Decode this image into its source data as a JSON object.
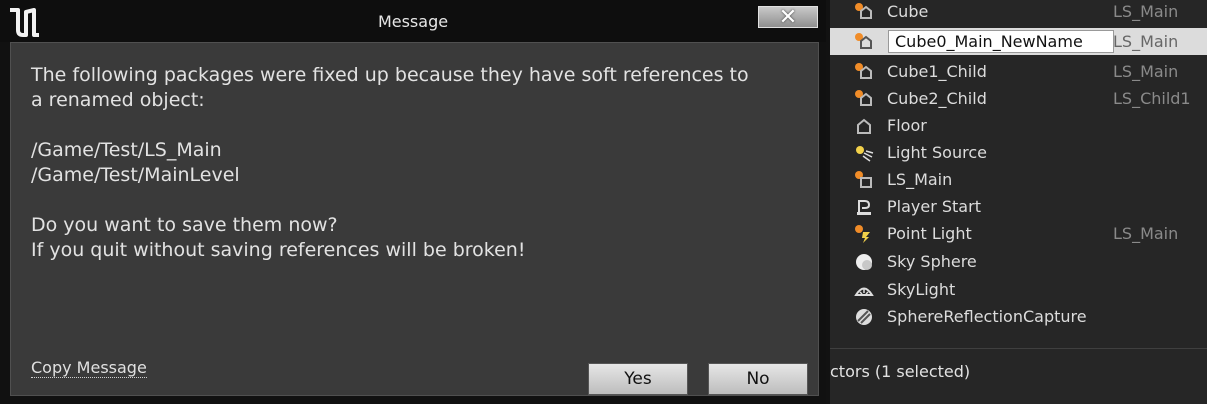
{
  "dialog": {
    "title": "Message",
    "close_label": "✕",
    "message": {
      "line1": "The following packages were fixed up because they have soft references to",
      "line2": "a renamed object:",
      "pkg1": "/Game/Test/LS_Main",
      "pkg2": "/Game/Test/MainLevel",
      "question1": "Do you want to save them now?",
      "question2": "If you quit without saving references will be broken!"
    },
    "copy_label": "Copy Message",
    "yes_label": "Yes",
    "no_label": "No"
  },
  "outliner": {
    "rows": [
      {
        "name": "Cube",
        "level": "LS_Main",
        "icon": "actor-icon"
      },
      {
        "name": "Cube0_Main_NewName",
        "level": "LS_Main",
        "icon": "actor-icon",
        "editing": true
      },
      {
        "name": "Cube1_Child",
        "level": "LS_Main",
        "icon": "actor-icon"
      },
      {
        "name": "Cube2_Child",
        "level": "LS_Child1",
        "icon": "actor-icon"
      },
      {
        "name": "Floor",
        "level": "",
        "icon": "static-mesh-icon"
      },
      {
        "name": "Light Source",
        "level": "",
        "icon": "directional-light-icon"
      },
      {
        "name": "LS_Main",
        "level": "",
        "icon": "level-script-icon"
      },
      {
        "name": "Player Start",
        "level": "",
        "icon": "player-start-icon"
      },
      {
        "name": "Point Light",
        "level": "LS_Main",
        "icon": "point-light-icon"
      },
      {
        "name": "Sky Sphere",
        "level": "",
        "icon": "sphere-icon"
      },
      {
        "name": "SkyLight",
        "level": "",
        "icon": "skylight-icon"
      },
      {
        "name": "SphereReflectionCapture",
        "level": "",
        "icon": "reflection-capture-icon"
      }
    ],
    "status": "ctors (1 selected)"
  },
  "colors": {
    "dialog_bg": "#3a3a3a",
    "titlebar_bg": "#0e0e0e",
    "panel_bg": "#262626",
    "selected_row": "#dcdcdc",
    "level_text": "#8a8a8a"
  }
}
